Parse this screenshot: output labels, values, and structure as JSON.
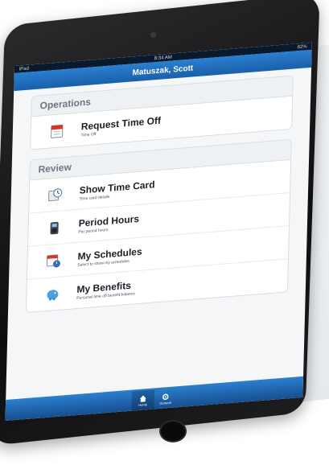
{
  "status_bar": {
    "carrier": "iPad",
    "time": "8:34 AM",
    "battery": "62%"
  },
  "nav": {
    "title": "Matuszak, Scott"
  },
  "sections": [
    {
      "header": "Operations",
      "items": [
        {
          "title": "Request Time Off",
          "subtitle": "Time Off",
          "icon": "calendar-icon"
        }
      ]
    },
    {
      "header": "Review",
      "items": [
        {
          "title": "Show Time Card",
          "subtitle": "Time card details",
          "icon": "clock-icon"
        },
        {
          "title": "Period Hours",
          "subtitle": "Per period hours",
          "icon": "timeclock-icon"
        },
        {
          "title": "My Schedules",
          "subtitle": "Select to show my schedules",
          "icon": "schedule-icon"
        },
        {
          "title": "My Benefits",
          "subtitle": "Personal time off benefit balance",
          "icon": "piggy-bank-icon"
        }
      ]
    }
  ],
  "tabbar": {
    "home_label": "Home",
    "general_label": "General"
  },
  "colors": {
    "nav_blue": "#1a5fa9",
    "accent_red": "#d9342b"
  }
}
